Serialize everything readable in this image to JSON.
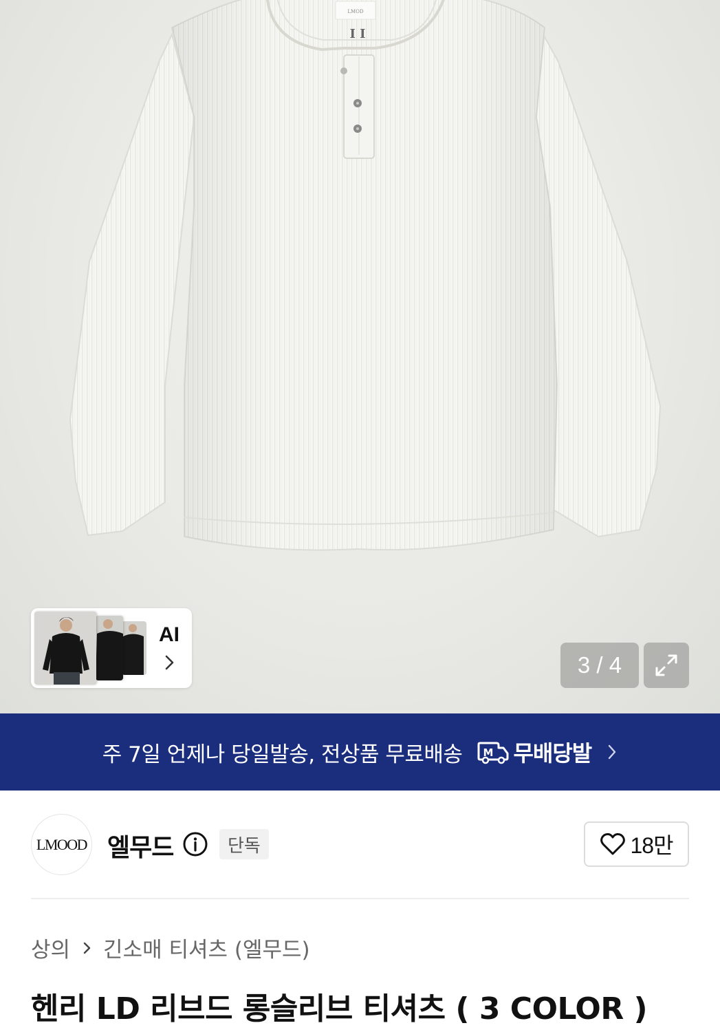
{
  "gallery": {
    "current_page": "3",
    "total_pages": "4",
    "page_indicator": "3 / 4",
    "ai_label": "AI",
    "icons": {
      "expand": "expand-arrows-icon",
      "ai_chevron": "chevron-right-icon"
    }
  },
  "promo_banner": {
    "text": "주 7일 언제나 당일발송, 전상품 무료배송",
    "service_name": "무배당발",
    "icons": {
      "logo": "delivery-truck-icon",
      "chevron": "chevron-right-icon"
    },
    "background_color": "#1b2d7d"
  },
  "brand": {
    "logo_text": "LMOOD",
    "name": "엘무드",
    "badge": "단독",
    "like_count": "18만",
    "icons": {
      "info": "info-icon",
      "like": "heart-icon"
    }
  },
  "breadcrumb": {
    "category": "상의",
    "subcategory": "긴소매 티셔츠 (엘무드)"
  },
  "product": {
    "title": "헨리 LD 리브드 롱슬리브 티셔츠 ( 3 COLOR )",
    "image_label_text": "LMOD"
  }
}
